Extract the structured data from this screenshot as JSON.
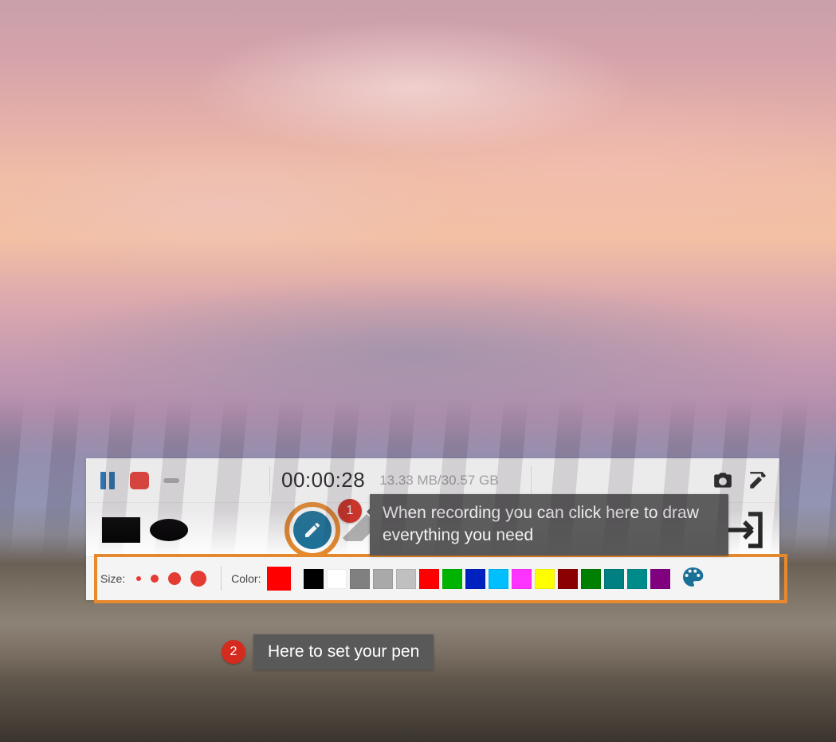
{
  "recorder": {
    "timer": "00:00:28",
    "file_size": "13.33 MB/30.57 GB"
  },
  "tools": {
    "rectangle": "rectangle",
    "ellipse": "ellipse",
    "line": "line",
    "arrow": "arrow",
    "pen": "pen",
    "eraser": "eraser"
  },
  "pen_settings": {
    "size_label": "Size:",
    "color_label": "Color:",
    "current_color": "#ff0000",
    "swatches": [
      "#000000",
      "#ffffff",
      "#808080",
      "#a9a9a9",
      "#c0c0c0",
      "#ff0000",
      "#00b300",
      "#0020bf",
      "#00bfff",
      "#ff33ff",
      "#ffff00",
      "#8b0000",
      "#008000",
      "#008080",
      "#008b8b",
      "#800080"
    ]
  },
  "callouts": {
    "one": {
      "num": "1",
      "text": "When recording you can click here to draw everything you need"
    },
    "two": {
      "num": "2",
      "text": "Here to set your pen"
    }
  }
}
